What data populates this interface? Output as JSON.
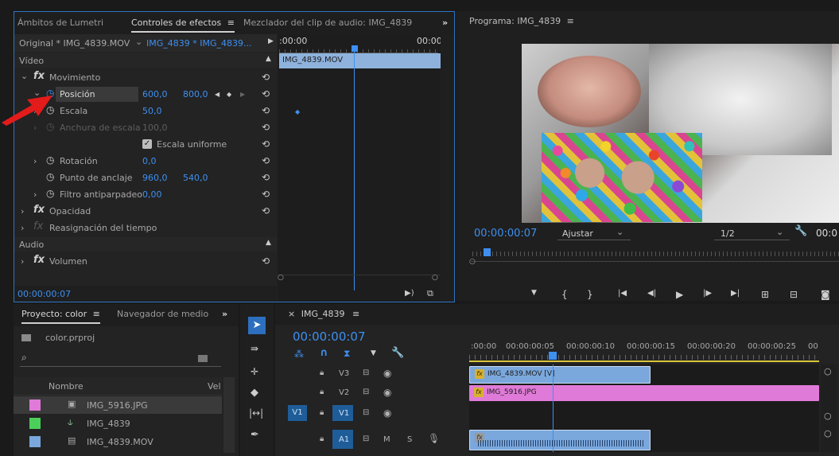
{
  "effects_panel": {
    "tabs": [
      "Ámbitos de Lumetri",
      "Controles de efectos",
      "Mezclador del clip de audio: IMG_4839"
    ],
    "tab_menu": "≡",
    "more": "»",
    "source_label": "Original * IMG_4839.MOV",
    "sequence_label": "IMG_4839 * IMG_4839...",
    "timeline_start": ":00:00",
    "timeline_end": "00:00",
    "clip_label": "IMG_4839.MOV",
    "video_header": "Vídeo",
    "movimiento": "Movimiento",
    "posicion": {
      "label": "Posición",
      "x": "600,0",
      "y": "800,0"
    },
    "escala": {
      "label": "Escala",
      "value": "50,0"
    },
    "anchura": {
      "label": "Anchura de escala",
      "value": "100,0"
    },
    "uniforme": "Escala uniforme",
    "rotacion": {
      "label": "Rotación",
      "value": "0,0"
    },
    "anclaje": {
      "label": "Punto de anclaje",
      "x": "960,0",
      "y": "540,0"
    },
    "filtro": {
      "label": "Filtro antiparpadeo",
      "value": "0,00"
    },
    "opacidad": "Opacidad",
    "reasignacion": "Reasignación del tiempo",
    "audio_header": "Audio",
    "volumen": "Volumen",
    "timecode": "00:00:00:07"
  },
  "program_monitor": {
    "title": "Programa: IMG_4839",
    "menu": "≡",
    "timecode": "00:00:00:07",
    "fit": "Ajustar",
    "resolution": "1/2",
    "right_timecode": "00:0"
  },
  "project_panel": {
    "tabs": [
      "Proyecto: color",
      "Navegador de medio"
    ],
    "menu": "≡",
    "more": "»",
    "project_file": "color.prproj",
    "column_name": "Nombre",
    "column_vel": "Vel",
    "items": [
      {
        "name": "IMG_5916.JPG",
        "color": "#e07ad8"
      },
      {
        "name": "IMG_4839",
        "color": "#4ccf5a"
      },
      {
        "name": "IMG_4839.MOV",
        "color": "#7aa7dc"
      }
    ]
  },
  "timeline": {
    "close": "×",
    "sequence": "IMG_4839",
    "menu": "≡",
    "timecode": "00:00:00:07",
    "ruler": [
      ":00:00",
      "00:00:00:05",
      "00:00:00:10",
      "00:00:00:15",
      "00:00:00:20",
      "00:00:00:25",
      "00"
    ],
    "tracks": [
      {
        "name": "V3",
        "src": ""
      },
      {
        "name": "V2",
        "src": ""
      },
      {
        "name": "V1",
        "src": "V1"
      },
      {
        "name": "A1",
        "src": "",
        "m": "M",
        "s": "S"
      }
    ],
    "clips": {
      "v3": "IMG_4839.MOV [V]",
      "v2": "IMG_5916.JPG"
    }
  },
  "colors": {
    "accent": "#2d8ceb",
    "clip_video": "#7aa7dc",
    "clip_image": "#e07ad8",
    "audio_clip": "#7aa7dc"
  }
}
